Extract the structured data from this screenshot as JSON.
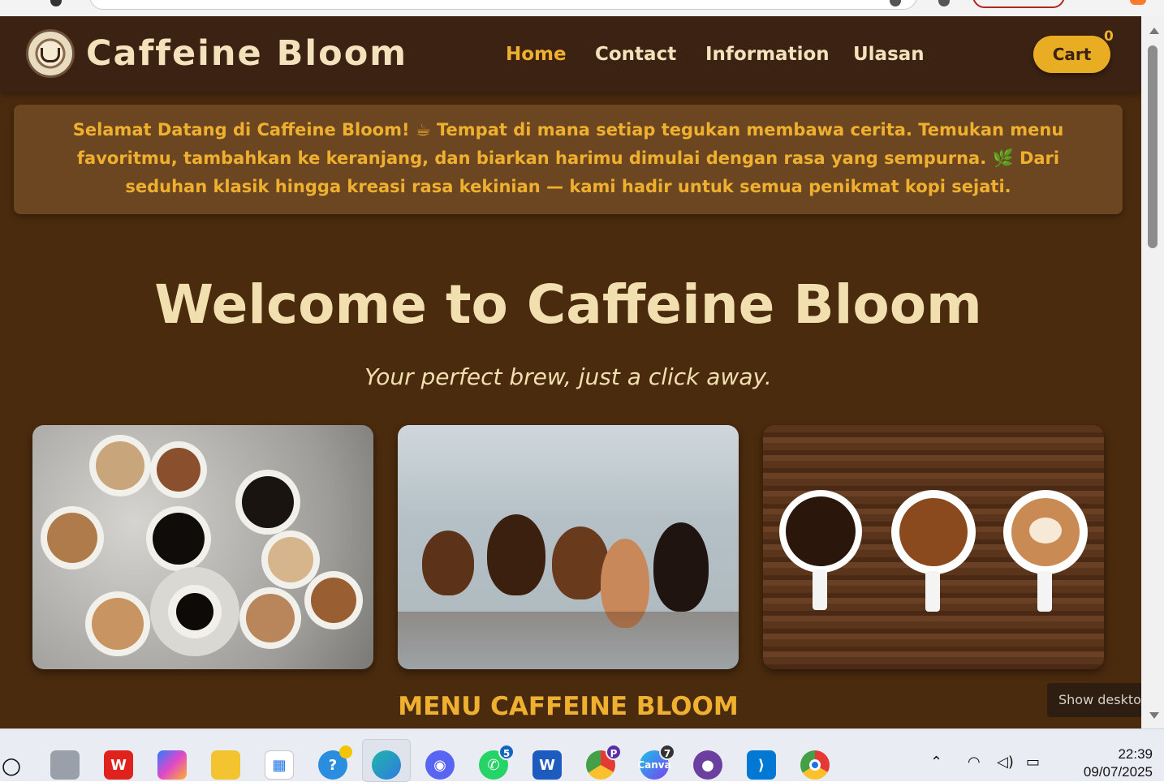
{
  "navbar": {
    "brand": "Caffeine Bloom",
    "links": [
      "Home",
      "Contact",
      "Information",
      "Ulasan"
    ],
    "active_link": "Home",
    "cart_label": "Cart",
    "cart_count": "0"
  },
  "banner": {
    "text": "Selamat Datang di Caffeine Bloom! ☕ Tempat di mana setiap tegukan membawa cerita. Temukan menu favoritmu, tambahkan ke keranjang, dan biarkan harimu dimulai dengan rasa yang sempurna. 🌿 Dari seduhan klasik hingga kreasi rasa kekinian — kami hadir untuk semua penikmat kopi sejati."
  },
  "hero": {
    "title": "Welcome to Caffeine Bloom",
    "subtitle": "Your perfect brew, just a click away."
  },
  "menu": {
    "title": "MENU CAFFEINE BLOOM"
  },
  "overlay": {
    "show_desktop": "Show desktop"
  },
  "taskbar": {
    "badges": {
      "whatsapp": "5",
      "chrome_profile": "P",
      "canva": "7"
    },
    "time": "22:39",
    "date": "09/07/2025"
  },
  "colors": {
    "page_bg": "#4b2b0e",
    "navbar_bg": "#3b2212",
    "accent": "#f0b02f",
    "cream": "#f1dfb0"
  }
}
